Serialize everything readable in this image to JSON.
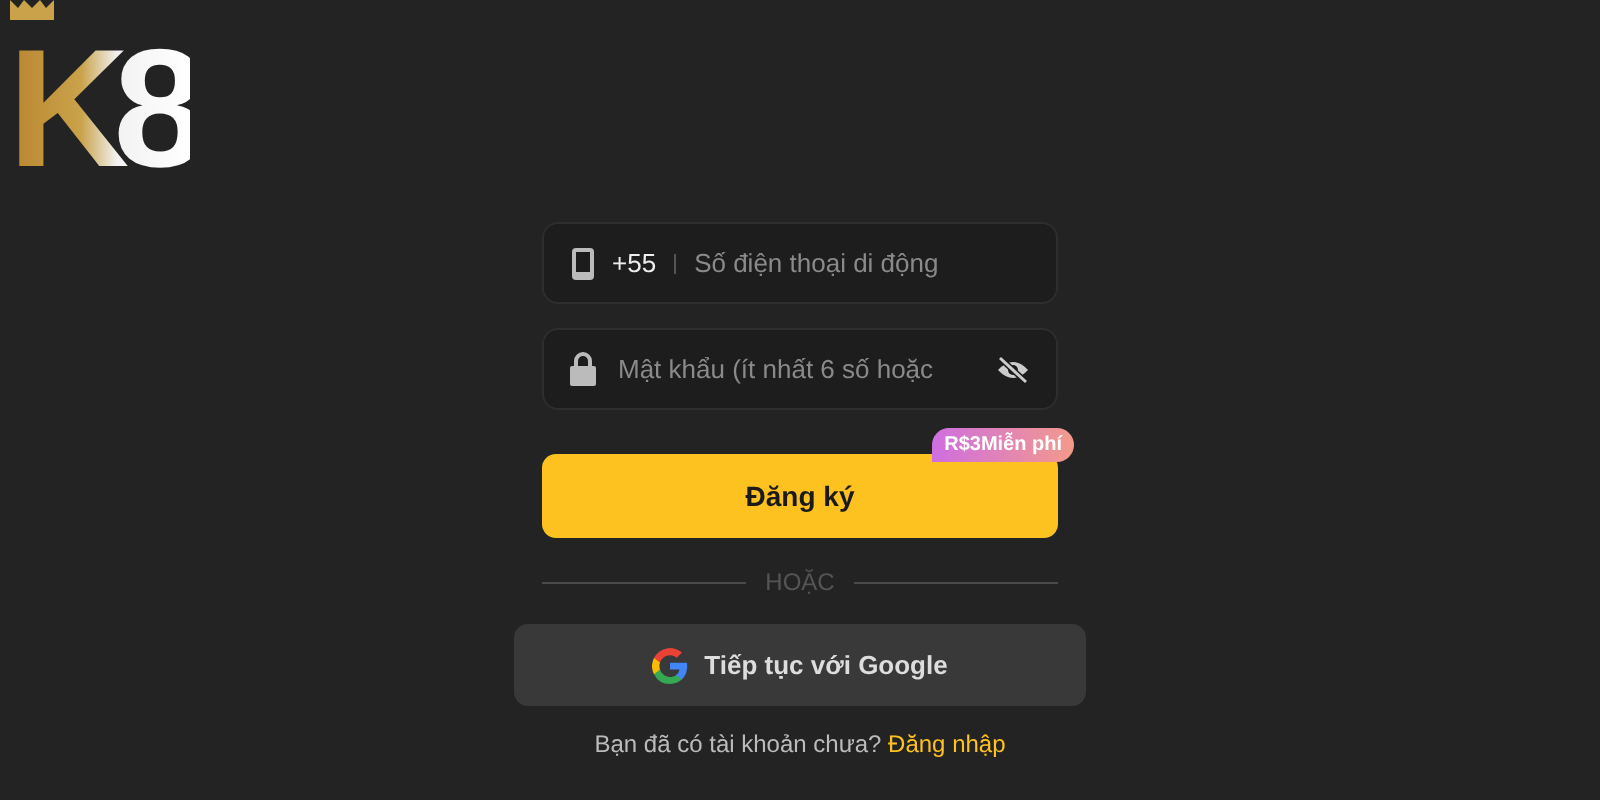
{
  "logo": {
    "text": "K8"
  },
  "phone_field": {
    "country_code": "+55",
    "placeholder": "Số điện thoại di động"
  },
  "password_field": {
    "placeholder": "Mật khẩu (ít nhất 6 số hoặc",
    "visible": false
  },
  "register_button": {
    "label": "Đăng ký",
    "badge": "R$3Miễn phí"
  },
  "divider": {
    "label": "HOẶC"
  },
  "google_button": {
    "label": "Tiếp tục với Google"
  },
  "footer": {
    "text": "Bạn đã có tài khoản chưa?",
    "link": "Đăng nhập"
  }
}
